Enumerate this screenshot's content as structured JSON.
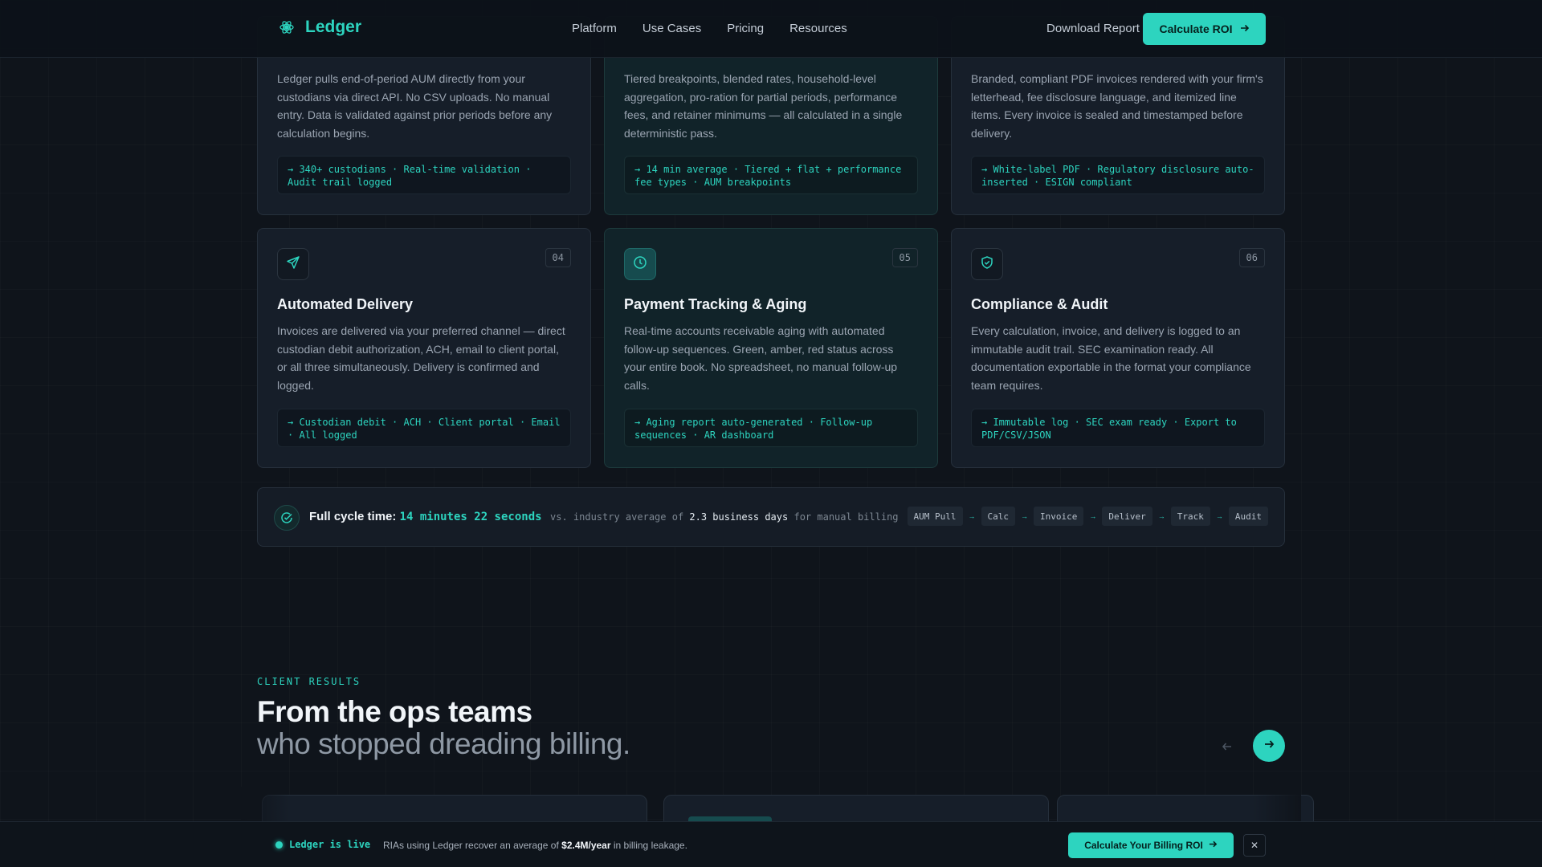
{
  "brand": {
    "name": "Ledger",
    "accent": "#2dd4bf"
  },
  "nav": {
    "items": [
      "Platform",
      "Use Cases",
      "Pricing",
      "Resources"
    ]
  },
  "header": {
    "download_label": "Download Report",
    "cta_label": "Calculate ROI"
  },
  "cards_top": [
    {
      "desc": "Ledger pulls end-of-period AUM directly from your custodians via direct API. No CSV uploads. No manual entry. Data is validated against prior periods before any calculation begins.",
      "tag": "→ 340+ custodians · Real-time validation · Audit trail logged"
    },
    {
      "desc": "Tiered breakpoints, blended rates, household-level aggregation, pro-ration for partial periods, performance fees, and retainer minimums — all calculated in a single deterministic pass.",
      "tag": "→ 14 min average · Tiered + flat + performance fee types · AUM breakpoints"
    },
    {
      "desc": "Branded, compliant PDF invoices rendered with your firm's letterhead, fee disclosure language, and itemized line items. Every invoice is sealed and timestamped before delivery.",
      "tag": "→ White-label PDF · Regulatory disclosure auto-inserted · ESIGN compliant"
    }
  ],
  "cards_bottom": [
    {
      "num": "04",
      "icon": "send-icon",
      "title": "Automated Delivery",
      "desc": "Invoices are delivered via your preferred channel — direct custodian debit authorization, ACH, email to client portal, or all three simultaneously. Delivery is confirmed and logged.",
      "tag": "→ Custodian debit · ACH · Client portal · Email · All logged"
    },
    {
      "num": "05",
      "icon": "clock-icon",
      "title": "Payment Tracking & Aging",
      "desc": "Real-time accounts receivable aging with automated follow-up sequences. Green, amber, red status across your entire book. No spreadsheet, no manual follow-up calls.",
      "tag": "→ Aging report auto-generated · Follow-up sequences · AR dashboard"
    },
    {
      "num": "06",
      "icon": "shield-check-icon",
      "title": "Compliance & Audit",
      "desc": "Every calculation, invoice, and delivery is logged to an immutable audit trail. SEC examination ready. All documentation exportable in the format your compliance team requires.",
      "tag": "→ Immutable log · SEC exam ready · Export to PDF/CSV/JSON"
    }
  ],
  "cycle": {
    "label": "Full cycle time:",
    "time": "14 minutes 22 seconds",
    "vs_prefix": "vs. industry average of",
    "vs_value": "2.3 business days",
    "vs_suffix": "for manual billing",
    "steps": [
      "AUM Pull",
      "Calc",
      "Invoice",
      "Deliver",
      "Track",
      "Audit"
    ]
  },
  "results": {
    "eyebrow": "CLIENT RESULTS",
    "title": "From the ops teams",
    "subtitle": "who stopped dreading billing."
  },
  "bottom_bar": {
    "live_label": "Ledger is live",
    "msg_prefix": "RIAs using Ledger recover an average of",
    "msg_value": "$2.4M/year",
    "msg_suffix": "in billing leakage.",
    "cta_label": "Calculate Your Billing ROI"
  }
}
